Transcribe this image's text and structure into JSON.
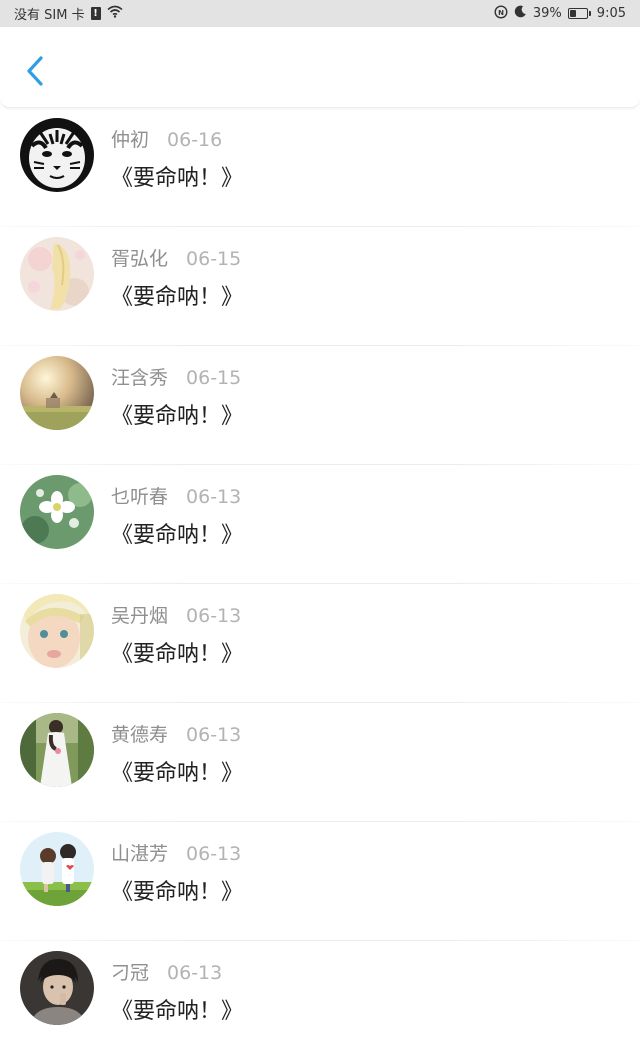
{
  "status_bar": {
    "carrier": "没有 SIM 卡",
    "sim_alert": "!",
    "battery": "39%",
    "battery_level": 0.39,
    "time": "9:05"
  },
  "nav": {
    "back_icon": "chevron-left-icon",
    "accent": "#2f9ee3"
  },
  "list": [
    {
      "name": "仲初",
      "date": "06-16",
      "title": "《要命呐！》",
      "avatar": "tiger"
    },
    {
      "name": "胥弘化",
      "date": "06-15",
      "title": "《要命呐！》",
      "avatar": "anime-girl"
    },
    {
      "name": "汪含秀",
      "date": "06-15",
      "title": "《要命呐！》",
      "avatar": "field-sunlight"
    },
    {
      "name": "乜听春",
      "date": "06-13",
      "title": "《要命呐！》",
      "avatar": "white-flower"
    },
    {
      "name": "吴丹烟",
      "date": "06-13",
      "title": "《要命呐！》",
      "avatar": "child"
    },
    {
      "name": "黄德寿",
      "date": "06-13",
      "title": "《要命呐！》",
      "avatar": "bride"
    },
    {
      "name": "山湛芳",
      "date": "06-13",
      "title": "《要命呐！》",
      "avatar": "couple-cartoon"
    },
    {
      "name": "刁冠",
      "date": "06-13",
      "title": "《要命呐！》",
      "avatar": "person-dark"
    }
  ]
}
